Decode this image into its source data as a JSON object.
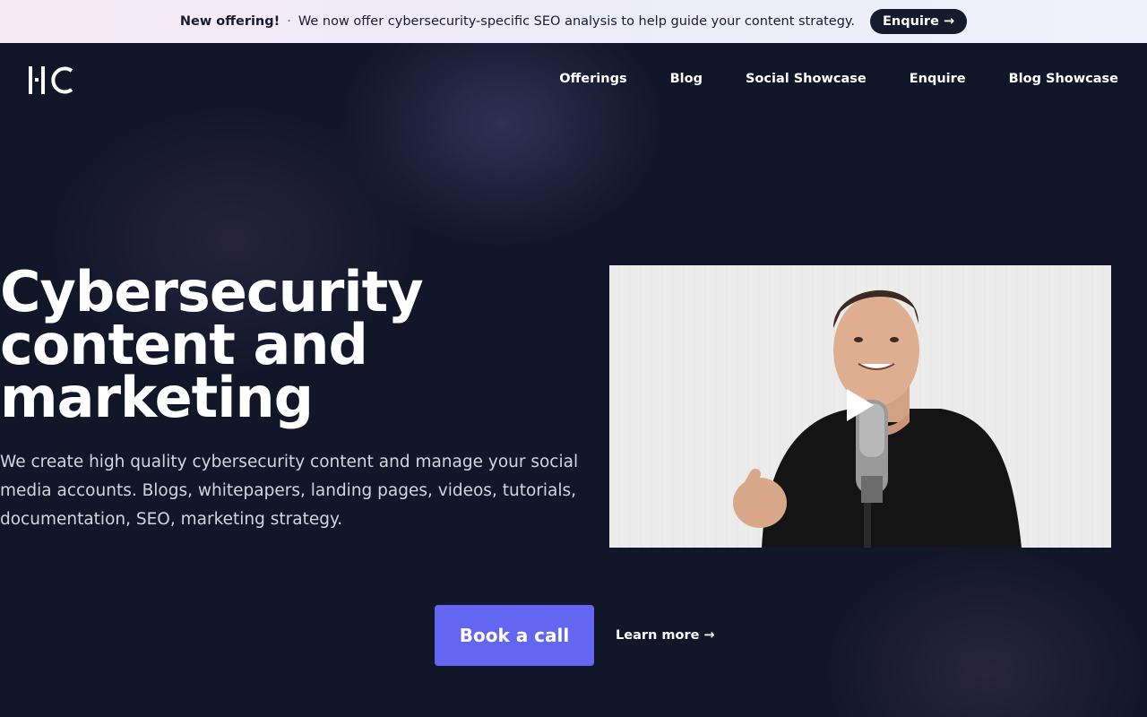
{
  "banner": {
    "highlight": "New offering!",
    "separator": "·",
    "message": "We now offer cybersecurity-specific SEO analysis to help guide your content strategy.",
    "button_label": "Enquire →"
  },
  "logo": {
    "text": "HC"
  },
  "nav": {
    "items": [
      "Offerings",
      "Blog",
      "Social Showcase",
      "Enquire",
      "Blog Showcase"
    ]
  },
  "hero": {
    "title": "Cybersecurity content and marketing",
    "description": "We create high quality cybersecurity content and manage your social media accounts. Blogs, whitepapers, landing pages, videos, tutorials, documentation, SEO, marketing strategy.",
    "primary_button": "Book a call",
    "secondary_link": "Learn more →"
  },
  "video": {
    "icon": "play-icon"
  },
  "colors": {
    "background": "#121629",
    "accent": "#6366f1",
    "banner_button": "#151a2c"
  }
}
